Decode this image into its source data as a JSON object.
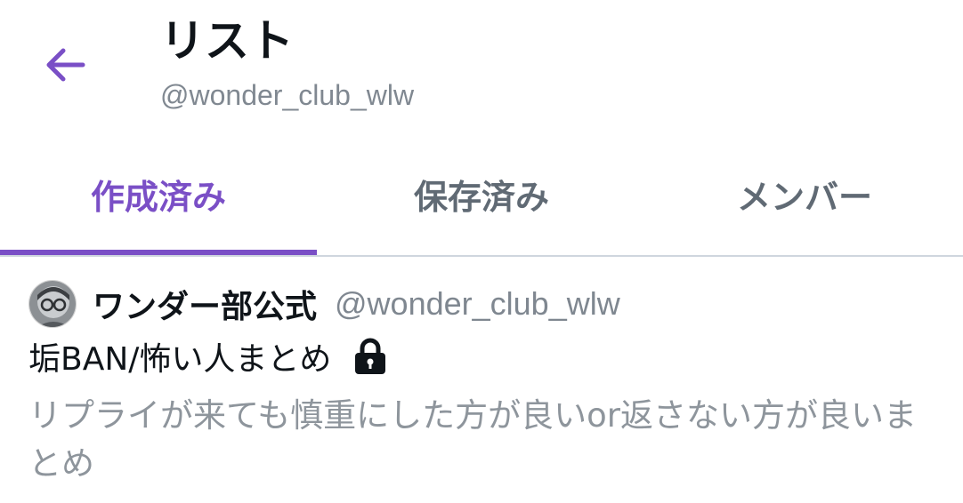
{
  "header": {
    "back_icon": "arrow-left-icon",
    "title": "リスト",
    "handle": "@wonder_club_wlw"
  },
  "tabs": [
    {
      "label": "作成済み",
      "active": true
    },
    {
      "label": "保存済み",
      "active": false
    },
    {
      "label": "メンバー",
      "active": false
    }
  ],
  "colors": {
    "accent": "#7a4fc6",
    "text_primary": "#0f1419",
    "text_secondary": "#7f8790",
    "divider": "#cfd6de"
  },
  "lists": [
    {
      "owner_name": "ワンダー部公式",
      "owner_handle": "@wonder_club_wlw",
      "name": "垢BAN/怖い人まとめ",
      "private_icon": "lock-icon",
      "description": "リプライが来ても慎重にした方が良いor返さない方が良いまとめ"
    }
  ]
}
